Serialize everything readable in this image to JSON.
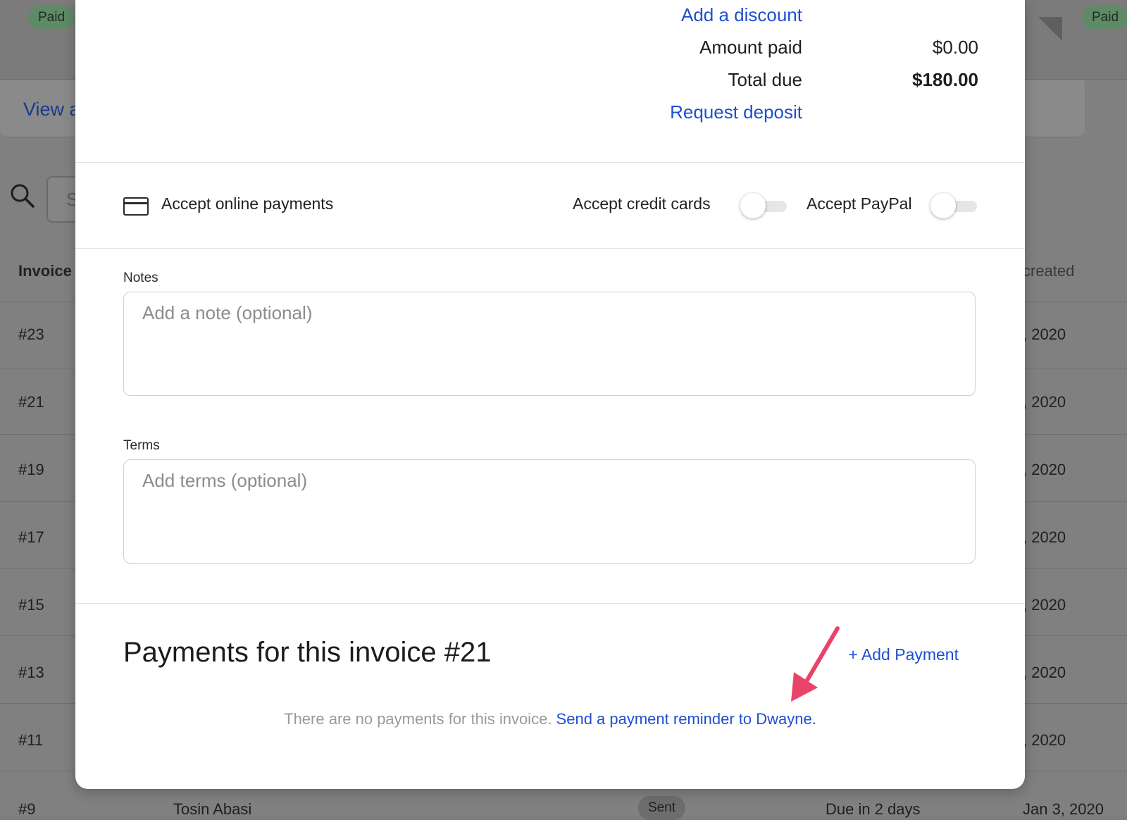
{
  "background": {
    "badge_left": "Paid",
    "badge_right": "Paid",
    "view_link": "View a",
    "search_placeholder_partial": "S",
    "table_headers": {
      "invoice": "Invoice",
      "created": "created"
    },
    "rows": [
      {
        "num": "#23",
        "date": ", 2020"
      },
      {
        "num": "#21",
        "date": ", 2020"
      },
      {
        "num": "#19",
        "date": ", 2020"
      },
      {
        "num": "#17",
        "date": ", 2020"
      },
      {
        "num": "#15",
        "date": ", 2020"
      },
      {
        "num": "#13",
        "date": ", 2020"
      },
      {
        "num": "#11",
        "date": ", 2020"
      }
    ],
    "last_row": {
      "num": "#9",
      "name": "Tosin Abasi",
      "status": "Sent",
      "due": "Due in 2 days",
      "date": "Jan 3, 2020"
    }
  },
  "modal": {
    "totals": {
      "add_discount": "Add a discount",
      "amount_paid_label": "Amount paid",
      "amount_paid_value": "$0.00",
      "total_due_label": "Total due",
      "total_due_value": "$180.00",
      "request_deposit": "Request deposit"
    },
    "online_payments": {
      "icon": "credit-card-icon",
      "label": "Accept online payments",
      "credit_cards_label": "Accept credit cards",
      "credit_cards_enabled": false,
      "paypal_label": "Accept PayPal",
      "paypal_enabled": false
    },
    "notes": {
      "label": "Notes",
      "placeholder": "Add a note (optional)",
      "value": ""
    },
    "terms": {
      "label": "Terms",
      "placeholder": "Add terms (optional)",
      "value": ""
    },
    "payments": {
      "title": "Payments for this invoice #21",
      "add_payment": "+ Add Payment",
      "empty_text": "There are no payments for this invoice.",
      "reminder_link": "Send a payment reminder to Dwayne."
    }
  },
  "colors": {
    "link": "#1f4fd1",
    "annotation_arrow": "#e8436a",
    "paid_badge": "#5f8a66"
  }
}
